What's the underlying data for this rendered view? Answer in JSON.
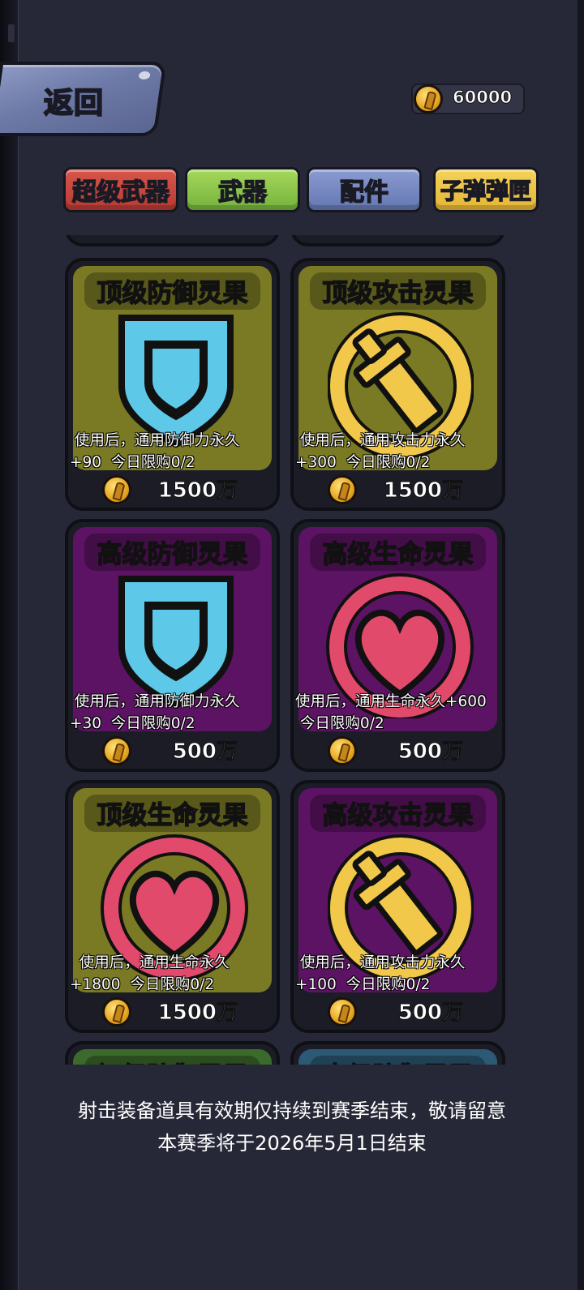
{
  "header": {
    "back_label": "返回",
    "coins": "60000"
  },
  "tabs": [
    {
      "label": "超级武器"
    },
    {
      "label": "武器"
    },
    {
      "label": "配件"
    },
    {
      "label": "子弹弹匣"
    }
  ],
  "items": [
    {
      "title": "顶级防御灵果",
      "desc_line1": " 使用后，通用防御力永久",
      "desc_line2": "+90  今日限购0/2",
      "price": "1500万",
      "bg": "#7b7a24",
      "icon": "shield-icon"
    },
    {
      "title": "顶级攻击灵果",
      "desc_line1": " 使用后，通用攻击力永久",
      "desc_line2": "+300  今日限购0/2",
      "price": "1500万",
      "bg": "#7b7a24",
      "icon": "sword-icon"
    },
    {
      "title": "高级防御灵果",
      "desc_line1": " 使用后，通用防御力永久",
      "desc_line2": "+30  今日限购0/2",
      "price": "500万",
      "bg": "#5d1364",
      "icon": "shield-icon"
    },
    {
      "title": "高级生命灵果",
      "desc_line1": "使用后，通用生命永久+600",
      "desc_line2": " 今日限购0/2",
      "price": "500万",
      "bg": "#5d1364",
      "icon": "heart-icon"
    },
    {
      "title": "顶级生命灵果",
      "desc_line1": "  使用后，通用生命永久",
      "desc_line2": "+1800  今日限购0/2",
      "price": "1500万",
      "bg": "#7b7a24",
      "icon": "heart-icon"
    },
    {
      "title": "高级攻击灵果",
      "desc_line1": " 使用后，通用攻击力永久",
      "desc_line2": "+100  今日限购0/2",
      "price": "500万",
      "bg": "#5d1364",
      "icon": "sword-icon"
    },
    {
      "title": "初级防御灵果"
    },
    {
      "title": "中级防御灵果"
    }
  ],
  "notice": {
    "line1": "射击装备道具有效期仅持续到赛季结束，敬请留意",
    "line2": "本赛季将于2026年5月1日结束"
  },
  "colors": {
    "olive": "#7b7a24",
    "purple": "#5d1364",
    "coin": "#e7a520",
    "shield": "#5dc8e8",
    "heart": "#e24a6c"
  }
}
